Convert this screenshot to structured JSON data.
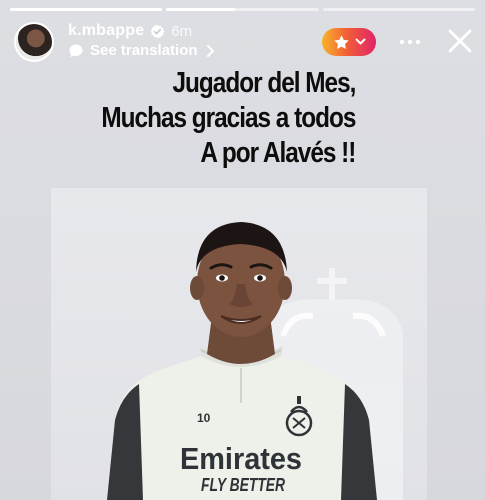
{
  "story": {
    "progress": [
      1,
      0.45,
      0
    ],
    "user": {
      "username": "k.mbappe",
      "time": "6m",
      "translate_label": "See translation"
    },
    "caption": [
      "Jugador del Mes,",
      "Muchas gracias  a todos",
      "A por Alavés !!"
    ],
    "photo": {
      "sleeve_number": "10",
      "sponsor": "Emirates",
      "sponsor_tagline": "FLY BETTER"
    },
    "colors": {
      "accent_gradient": [
        "#f7b32b",
        "#f26035",
        "#e0246a"
      ],
      "kit": "#eff1ea",
      "sleeve": "#34383a"
    }
  }
}
